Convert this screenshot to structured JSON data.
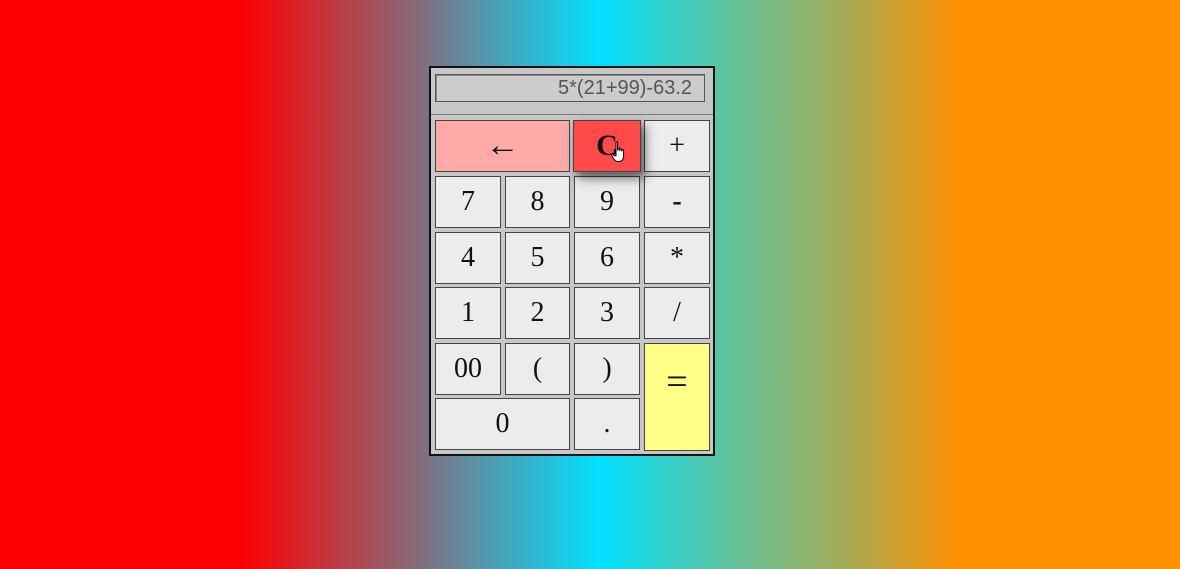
{
  "display": {
    "expression": "5*(21+99)-63.2"
  },
  "buttons": {
    "backspace": "←",
    "clear": "C",
    "plus": "+",
    "seven": "7",
    "eight": "8",
    "nine": "9",
    "minus": "-",
    "four": "4",
    "five": "5",
    "six": "6",
    "multiply": "*",
    "one": "1",
    "two": "2",
    "three": "3",
    "divide": "/",
    "double_zero": "00",
    "open_paren": "(",
    "close_paren": ")",
    "equals": "=",
    "zero": "0",
    "decimal": "."
  },
  "colors": {
    "backspace": "#ffa9a9",
    "clear": "#ff4a4a",
    "equals": "#ffff88",
    "key": "#ececec"
  },
  "icons": {
    "cursor": "hand-pointer-icon"
  }
}
